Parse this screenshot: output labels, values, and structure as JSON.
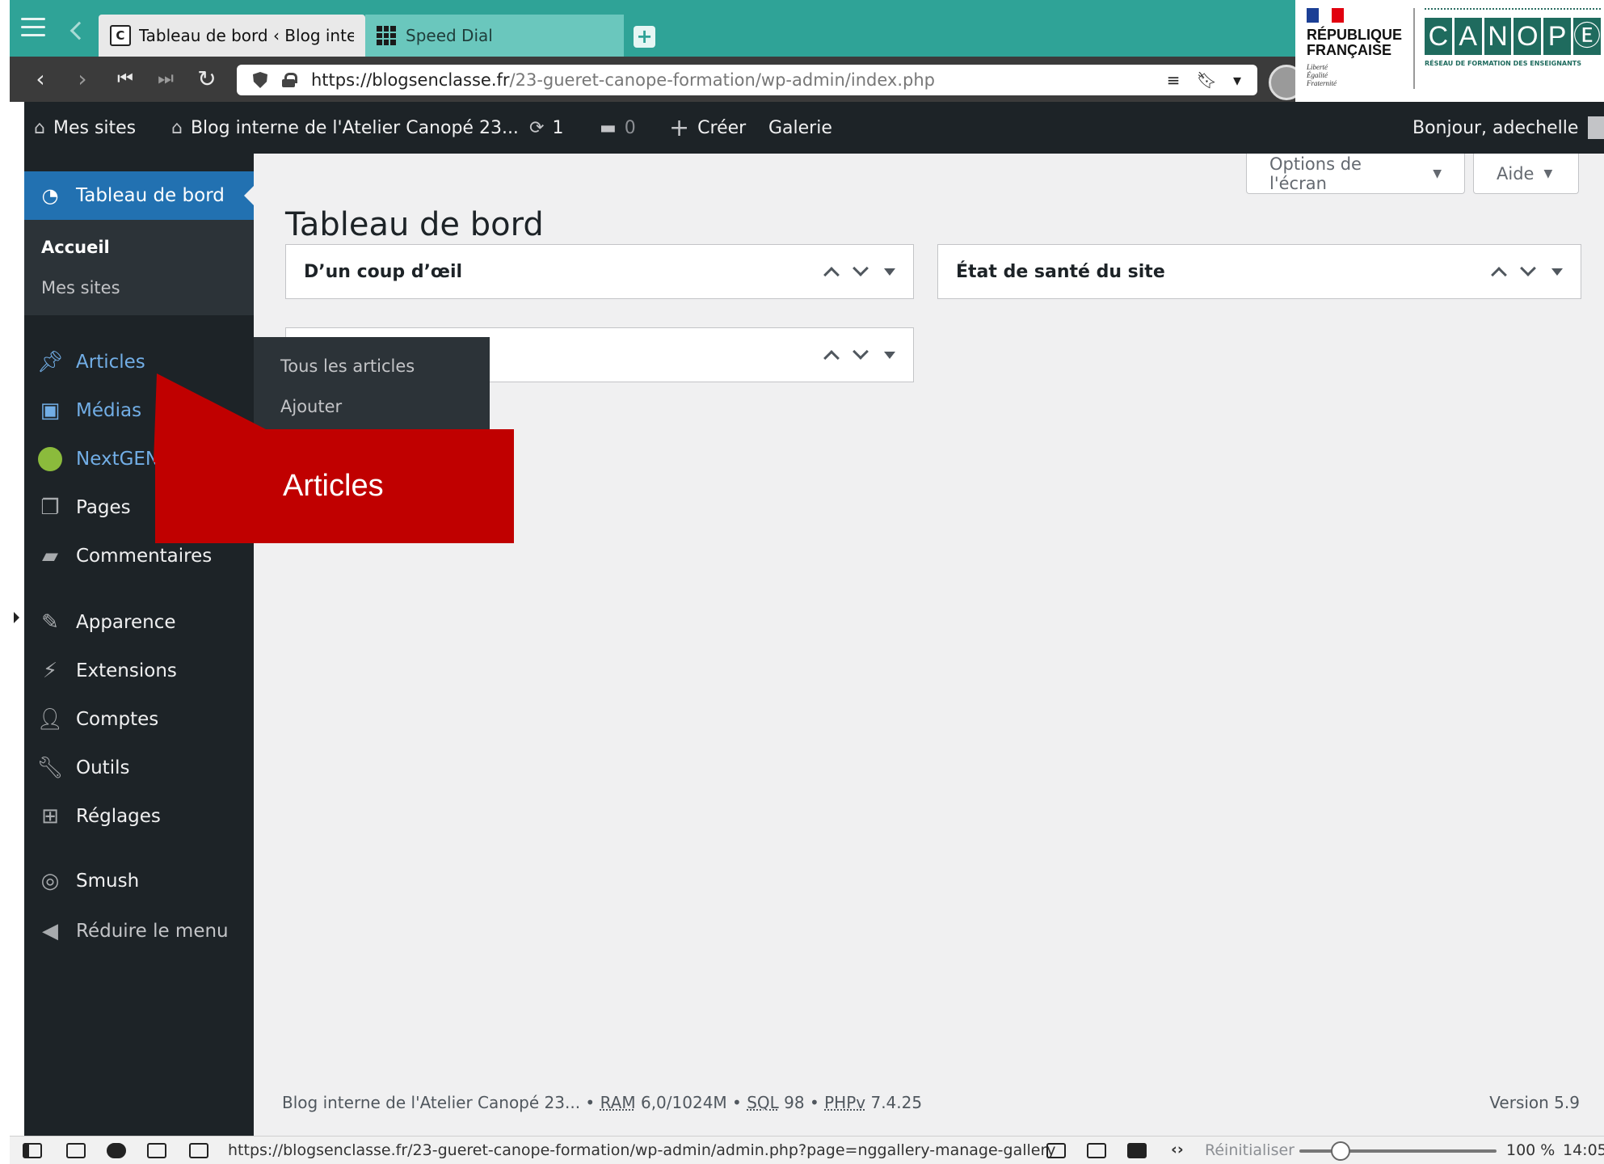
{
  "browser": {
    "tabs": [
      {
        "label": "Tableau de bord ‹ Blog inte",
        "icon": "page-c-icon",
        "icon_letter": "C",
        "active": true
      },
      {
        "label": "Speed Dial",
        "icon": "speed-dial-icon",
        "active": false
      }
    ],
    "url_domain": "https://blogsenclasse.fr",
    "url_path": "/23-gueret-canope-formation/wp-admin/index.php",
    "accent": "#2fa397"
  },
  "logos": {
    "rf_title_line1": "RÉPUBLIQUE",
    "rf_title_line2": "FRANÇAISE",
    "rf_motto": [
      "Liberté",
      "Égalité",
      "Fraternité"
    ],
    "canope_letters": [
      "C",
      "A",
      "N",
      "O",
      "P",
      "Ⓔ"
    ],
    "canope_subtitle": "RÉSEAU DE FORMATION DES ENSEIGNANTS"
  },
  "adminbar": {
    "my_sites": "Mes sites",
    "site_name": "Blog interne de l'Atelier Canopé 23...",
    "updates_count": "1",
    "comments_count": "0",
    "create": "Créer",
    "gallery": "Galerie",
    "greeting": "Bonjour, adechelle"
  },
  "sidebar": {
    "current": "Tableau de bord",
    "submenu": [
      "Accueil",
      "Mes sites"
    ],
    "items": [
      {
        "label": "Articles",
        "icon": "pin-icon"
      },
      {
        "label": "Médias",
        "icon": "media-icon"
      },
      {
        "label": "NextGEN",
        "icon": "nextgen-icon"
      },
      {
        "label": "Pages",
        "icon": "pages-icon"
      },
      {
        "label": "Commentaires",
        "icon": "comment-icon"
      },
      {
        "label": "Apparence",
        "icon": "brush-icon"
      },
      {
        "label": "Extensions",
        "icon": "plugin-icon"
      },
      {
        "label": "Comptes",
        "icon": "user-icon"
      },
      {
        "label": "Outils",
        "icon": "wrench-icon"
      },
      {
        "label": "Réglages",
        "icon": "settings-icon"
      },
      {
        "label": "Smush",
        "icon": "smush-icon"
      },
      {
        "label": "Réduire le menu",
        "icon": "collapse-icon"
      }
    ],
    "accent": "#2271b1"
  },
  "flyout": {
    "items": [
      "Tous les articles",
      "Ajouter"
    ]
  },
  "callout": {
    "label": "Articles",
    "color": "#c00000"
  },
  "main": {
    "screen_options": "Options de l'écran",
    "help": "Aide",
    "title": "Tableau de bord",
    "widgets": [
      {
        "title": "D’un coup d’œil"
      },
      {
        "title": "État de santé du site"
      },
      {
        "title": ""
      }
    ],
    "footer": {
      "site": "Blog interne de l'Atelier Canopé 23...",
      "ram_label": "RAM",
      "ram_value": "6,0/1024M",
      "sql_label": "SQL",
      "sql_value": "98",
      "php_label": "PHPv",
      "php_value": "7.4.25",
      "version": "Version 5.9"
    }
  },
  "statusbar": {
    "url": "https://blogsenclasse.fr/23-gueret-canope-formation/wp-admin/admin.php?page=nggallery-manage-gallery",
    "reset": "Réinitialiser",
    "zoom": "100 %",
    "time": "14:05"
  }
}
